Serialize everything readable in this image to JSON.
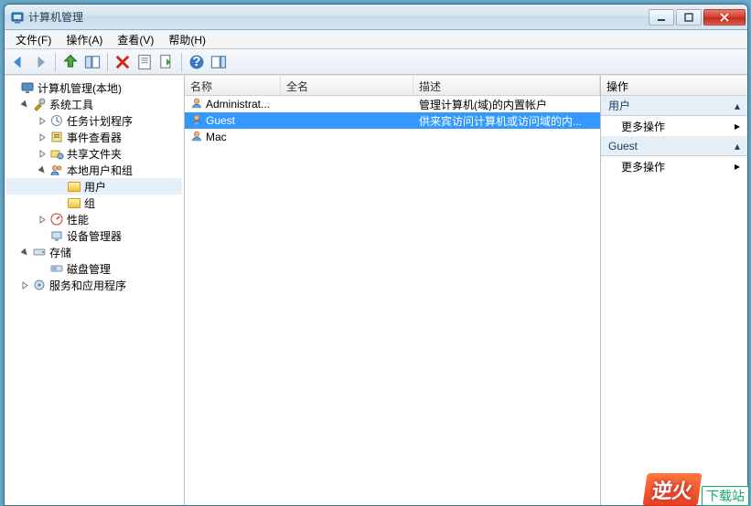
{
  "window": {
    "title": "计算机管理"
  },
  "menu": {
    "file": "文件(F)",
    "action": "操作(A)",
    "view": "查看(V)",
    "help": "帮助(H)"
  },
  "tree": {
    "root": "计算机管理(本地)",
    "system_tools": "系统工具",
    "task_scheduler": "任务计划程序",
    "event_viewer": "事件查看器",
    "shared_folders": "共享文件夹",
    "local_users_groups": "本地用户和组",
    "users": "用户",
    "groups": "组",
    "performance": "性能",
    "device_manager": "设备管理器",
    "storage": "存储",
    "disk_management": "磁盘管理",
    "services_apps": "服务和应用程序"
  },
  "list": {
    "headers": {
      "name": "名称",
      "fullname": "全名",
      "description": "描述"
    },
    "rows": [
      {
        "name": "Administrat...",
        "fullname": "",
        "description": "管理计算机(域)的内置帐户"
      },
      {
        "name": "Guest",
        "fullname": "",
        "description": "供来宾访问计算机或访问域的内..."
      },
      {
        "name": "Mac",
        "fullname": "",
        "description": ""
      }
    ],
    "selected_index": 1
  },
  "actions": {
    "header": "操作",
    "sections": [
      {
        "title": "用户",
        "items": [
          "更多操作"
        ]
      },
      {
        "title": "Guest",
        "items": [
          "更多操作"
        ]
      }
    ]
  },
  "watermark": {
    "brand": "逆火",
    "site": "下载站"
  }
}
